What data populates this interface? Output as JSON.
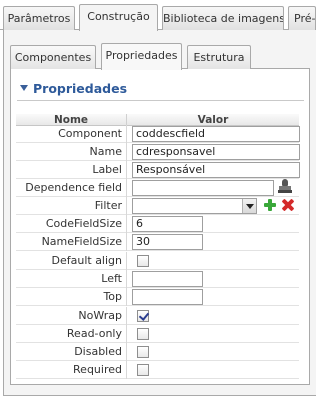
{
  "outer_tabs": [
    "Parâmetros",
    "Construção",
    "Biblioteca de imagens",
    "Pré-"
  ],
  "inner_tabs": [
    "Componentes",
    "Propriedades",
    "Estrutura"
  ],
  "section": {
    "title": "Propriedades"
  },
  "table": {
    "headers": {
      "name": "Nome",
      "value": "Valor"
    },
    "rows": [
      {
        "name": "Component",
        "type": "text",
        "value": "coddescfield"
      },
      {
        "name": "Name",
        "type": "text",
        "value": "cdresponsavel"
      },
      {
        "name": "Label",
        "type": "text",
        "value": "Responsável"
      },
      {
        "name": "Dependence field",
        "type": "text-icon",
        "value": "",
        "icon": "stamp-icon"
      },
      {
        "name": "Filter",
        "type": "select",
        "value": "",
        "icons": [
          "add-icon",
          "delete-icon"
        ]
      },
      {
        "name": "CodeFieldSize",
        "type": "text-short",
        "value": "6"
      },
      {
        "name": "NameFieldSize",
        "type": "text-short",
        "value": "30"
      },
      {
        "name": "Default align",
        "type": "checkbox",
        "checked": false
      },
      {
        "name": "Left",
        "type": "text-short",
        "value": ""
      },
      {
        "name": "Top",
        "type": "text-short",
        "value": ""
      },
      {
        "name": "NoWrap",
        "type": "checkbox",
        "checked": true
      },
      {
        "name": "Read-only",
        "type": "checkbox",
        "checked": false
      },
      {
        "name": "Disabled",
        "type": "checkbox",
        "checked": false
      },
      {
        "name": "Required",
        "type": "checkbox",
        "checked": false
      }
    ]
  },
  "colors": {
    "accent": "#2e5a9a",
    "add": "#3aa83a",
    "delete": "#d42a2a"
  }
}
